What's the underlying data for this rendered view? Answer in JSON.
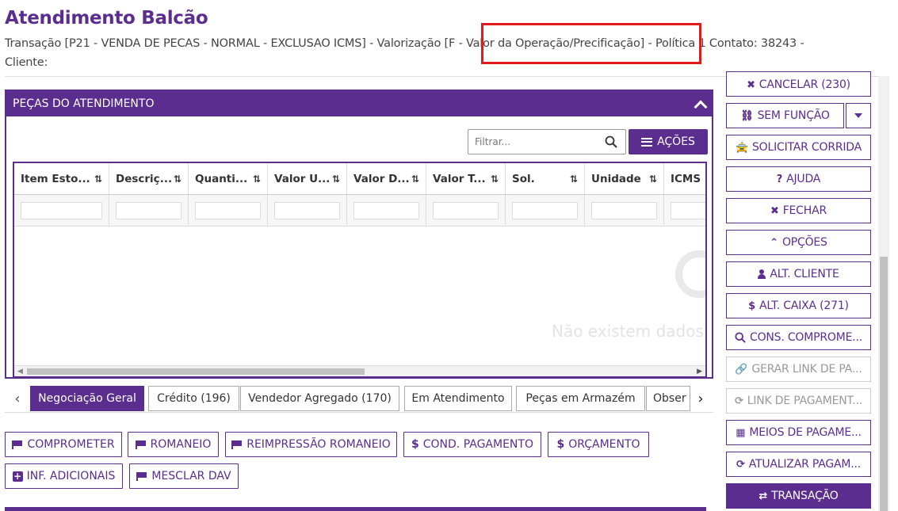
{
  "header": {
    "title": "Atendimento Balcão",
    "line1": "Transação  [P21 - VENDA DE PECAS - NORMAL - EXCLUSAO ICMS] - Valorização [F - Valor da Operação/Precificação] - Política 1 Contato: 38243 -",
    "line2": "Cliente:"
  },
  "panel": {
    "title": "PEÇAS DO ATENDIMENTO",
    "filter_placeholder": "Filtrar...",
    "actions_label": "AÇÕES",
    "columns": [
      "Item Esto...",
      "Descriç...",
      "Quanti...",
      "Valor U...",
      "Valor D...",
      "Valor T...",
      "Sol.",
      "Unidade",
      "ICMS F"
    ],
    "empty_text": "Não existem dados"
  },
  "tabs": [
    "Negociação Geral",
    "Crédito (196)",
    "Vendedor Agregado (170)",
    "Em Atendimento",
    "Peças em Armazém",
    "Obser"
  ],
  "actions_row1": [
    "COMPROMETER",
    "ROMANEIO",
    "REIMPRESSÃO ROMANEIO",
    "COND. PAGAMENTO",
    "ORÇAMENTO"
  ],
  "actions_row2": [
    "INF. ADICIONAIS",
    "MESCLAR DAV"
  ],
  "right_buttons": {
    "cancelar": "CANCELAR (230)",
    "sem_funcao": "SEM FUNÇÃO",
    "solicitar_corrida": "SOLICITAR CORRIDA",
    "ajuda": "AJUDA",
    "fechar": "FECHAR",
    "opcoes": "OPÇÕES",
    "alt_cliente": "ALT. CLIENTE",
    "alt_caixa": "ALT. CAIXA (271)",
    "cons_comprome": "CONS. COMPROME...",
    "gerar_link": "GERAR LINK DE PA...",
    "link_pagamento": "LINK DE PAGAMENT...",
    "meios_pagamento": "MEIOS DE PAGAME...",
    "atualizar_pagam": "ATUALIZAR PAGAM...",
    "transacao": "TRANSAÇÃO"
  }
}
